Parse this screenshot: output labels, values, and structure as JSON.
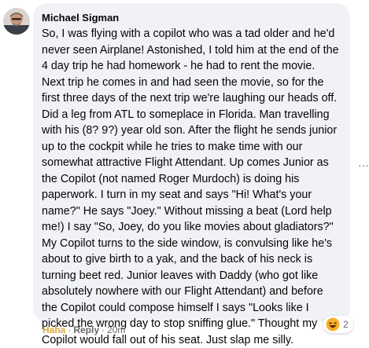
{
  "comment": {
    "author": "Michael Sigman",
    "text": "So, I was flying with a copilot who was a tad older and he'd never seen Airplane! Astonished, I told him at the end of the 4 day trip he had homework - he had to rent the movie. Next trip he comes in and had seen the movie, so for the first three days of the next trip we're laughing our heads off. Did a leg from ATL to someplace in Florida. Man travelling with his (8? 9?) year old son. After the flight he sends junior up to the cockpit while he tries to make time with our somewhat attractive Flight Attendant. Up comes Junior as the Copilot (not named Roger Murdoch) is doing his paperwork. I turn in my seat and says \"Hi! What's your name?\" He says \"Joey.\" Without missing a beat (Lord help me!) I say \"So, Joey, do you like movies about gladiators?\" My Copilot turns to the side window, is convulsing like he's about to give birth to a yak, and the back of his neck is turning beet red. Junior leaves with Daddy (who got like absolutely nowhere with our Flight Attendant) and before the Copilot could compose himself I says \"Looks like I picked the wrong day to stop sniffing glue.\" Thought my Copilot would fall out of his seat. Just slap me silly.",
    "reaction_icon": "haha-emoji-icon",
    "reaction_count": "2",
    "reaction_label": "Haha",
    "reply_label": "Reply",
    "separator": "·",
    "timestamp": "20m"
  },
  "more_options": "···",
  "colors": {
    "bubble": "#f0f2f5",
    "haha_accent": "#e0a93a",
    "meta_text": "#65676b"
  }
}
